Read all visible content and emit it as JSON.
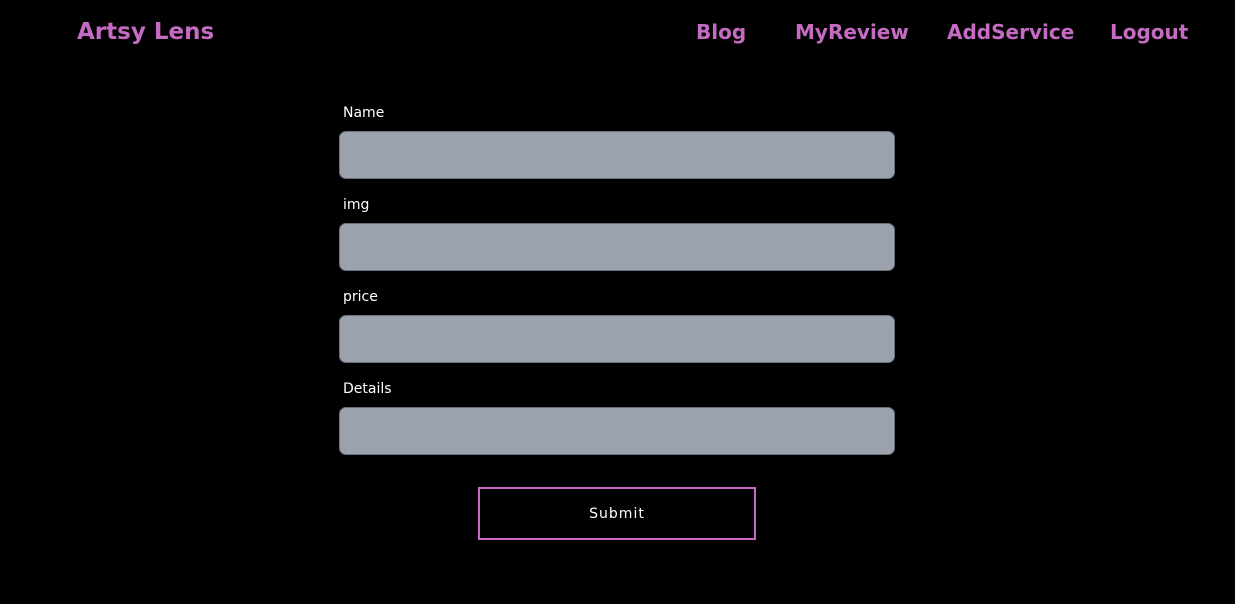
{
  "header": {
    "brand": "Artsy Lens",
    "nav": {
      "blog": "Blog",
      "my_review": "MyReview",
      "add_service": "AddService",
      "logout": "Logout"
    }
  },
  "form": {
    "fields": [
      {
        "label": "Name",
        "value": ""
      },
      {
        "label": "img",
        "value": ""
      },
      {
        "label": "price",
        "value": ""
      },
      {
        "label": "Details",
        "value": ""
      }
    ],
    "submit_label": "Submit"
  },
  "colors": {
    "accent": "#c66bc4",
    "background": "#000000",
    "input_background": "#9ca3af",
    "label_text": "#ffffff"
  }
}
